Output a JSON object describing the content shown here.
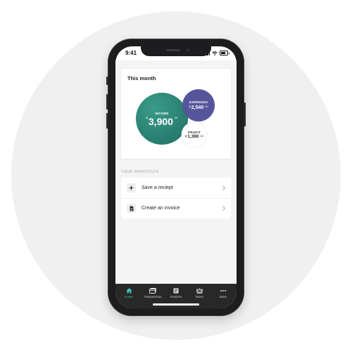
{
  "status_bar": {
    "time": "9:41"
  },
  "summary": {
    "title": "This month",
    "income": {
      "label": "INCOME",
      "currency": "$",
      "amount": "3,900",
      "cents": ".00"
    },
    "expenses": {
      "label": "EXPENSES",
      "currency": "$",
      "amount": "2,540",
      "cents": ".00"
    },
    "profit": {
      "label": "PROFIT",
      "currency": "$",
      "amount": "1,360",
      "cents": ".00"
    }
  },
  "shortcuts": {
    "section_label": "YOUR SHORTCUTS",
    "items": [
      {
        "label": "Save a reciept",
        "icon": "plus-icon"
      },
      {
        "label": "Create an invoice",
        "icon": "document-icon"
      }
    ]
  },
  "tabbar": {
    "active_color": "#43c2b4",
    "tabs": [
      {
        "label": "Home",
        "icon": "home-icon"
      },
      {
        "label": "Transactions",
        "icon": "cards-icon"
      },
      {
        "label": "Invoices",
        "icon": "invoice-icon"
      },
      {
        "label": "Taxes",
        "icon": "crown-icon"
      },
      {
        "label": "More",
        "icon": "more-icon"
      }
    ]
  },
  "colors": {
    "income": "#2a7f70",
    "expenses": "#56559c",
    "tabbar_bg": "#282828"
  }
}
